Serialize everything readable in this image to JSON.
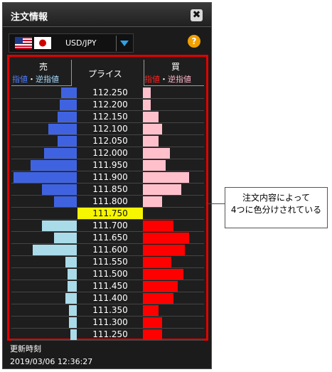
{
  "window": {
    "title": "注文情報",
    "close_glyph": "✖"
  },
  "pair": {
    "symbol": "USD/JPY",
    "base_flag": "us-flag-icon",
    "quote_flag": "jp-flag-icon",
    "help_glyph": "?"
  },
  "board": {
    "header": {
      "sell": "売",
      "price": "プライス",
      "buy": "買",
      "sell_sub": {
        "limit": "指値",
        "dot": "・",
        "stop": "逆指値"
      },
      "buy_sub": {
        "limit": "指値",
        "dot": "・",
        "stop": "逆指値"
      }
    },
    "current_price": "111.750",
    "colors": {
      "sell_limit": "#3f63e0",
      "sell_stop": "#a9dbe8",
      "buy_limit": "#ff0000",
      "buy_stop": "#ffc0cc",
      "current": "#f6f600"
    },
    "rows": [
      {
        "price": "112.250",
        "sell": 0.08,
        "buy": 0.04,
        "sell_type": "limit",
        "buy_type": "stop"
      },
      {
        "price": "112.200",
        "sell": 0.09,
        "buy": 0.04,
        "sell_type": "limit",
        "buy_type": "stop"
      },
      {
        "price": "112.150",
        "sell": 0.1,
        "buy": 0.08,
        "sell_type": "limit",
        "buy_type": "stop"
      },
      {
        "price": "112.100",
        "sell": 0.15,
        "buy": 0.1,
        "sell_type": "limit",
        "buy_type": "stop"
      },
      {
        "price": "112.050",
        "sell": 0.1,
        "buy": 0.08,
        "sell_type": "limit",
        "buy_type": "stop"
      },
      {
        "price": "112.000",
        "sell": 0.17,
        "buy": 0.14,
        "sell_type": "limit",
        "buy_type": "stop"
      },
      {
        "price": "111.950",
        "sell": 0.24,
        "buy": 0.12,
        "sell_type": "limit",
        "buy_type": "stop"
      },
      {
        "price": "111.900",
        "sell": 0.33,
        "buy": 0.24,
        "sell_type": "limit",
        "buy_type": "stop"
      },
      {
        "price": "111.850",
        "sell": 0.18,
        "buy": 0.2,
        "sell_type": "limit",
        "buy_type": "stop"
      },
      {
        "price": "111.800",
        "sell": 0.12,
        "buy": 0.1,
        "sell_type": "limit",
        "buy_type": "stop"
      },
      {
        "price": "111.750",
        "sell": 0,
        "buy": 0,
        "sell_type": "none",
        "buy_type": "none",
        "current": true
      },
      {
        "price": "111.700",
        "sell": 0.18,
        "buy": 0.16,
        "sell_type": "stop",
        "buy_type": "limit"
      },
      {
        "price": "111.650",
        "sell": 0.12,
        "buy": 0.24,
        "sell_type": "stop",
        "buy_type": "limit"
      },
      {
        "price": "111.600",
        "sell": 0.23,
        "buy": 0.22,
        "sell_type": "stop",
        "buy_type": "limit"
      },
      {
        "price": "111.550",
        "sell": 0.06,
        "buy": 0.15,
        "sell_type": "stop",
        "buy_type": "limit"
      },
      {
        "price": "111.500",
        "sell": 0.05,
        "buy": 0.21,
        "sell_type": "stop",
        "buy_type": "limit"
      },
      {
        "price": "111.450",
        "sell": 0.05,
        "buy": 0.18,
        "sell_type": "stop",
        "buy_type": "limit"
      },
      {
        "price": "111.400",
        "sell": 0.06,
        "buy": 0.16,
        "sell_type": "stop",
        "buy_type": "limit"
      },
      {
        "price": "111.350",
        "sell": 0.04,
        "buy": 0.08,
        "sell_type": "stop",
        "buy_type": "limit"
      },
      {
        "price": "111.300",
        "sell": 0.04,
        "buy": 0.1,
        "sell_type": "stop",
        "buy_type": "limit"
      },
      {
        "price": "111.250",
        "sell": 0.035,
        "buy": 0.1,
        "sell_type": "stop",
        "buy_type": "limit"
      }
    ]
  },
  "footer": {
    "updated_label": "更新時刻",
    "updated_time": "2019/03/06 12:36:27"
  },
  "callout": {
    "line1": "注文内容によって",
    "line2": "4つに色分けされている"
  }
}
